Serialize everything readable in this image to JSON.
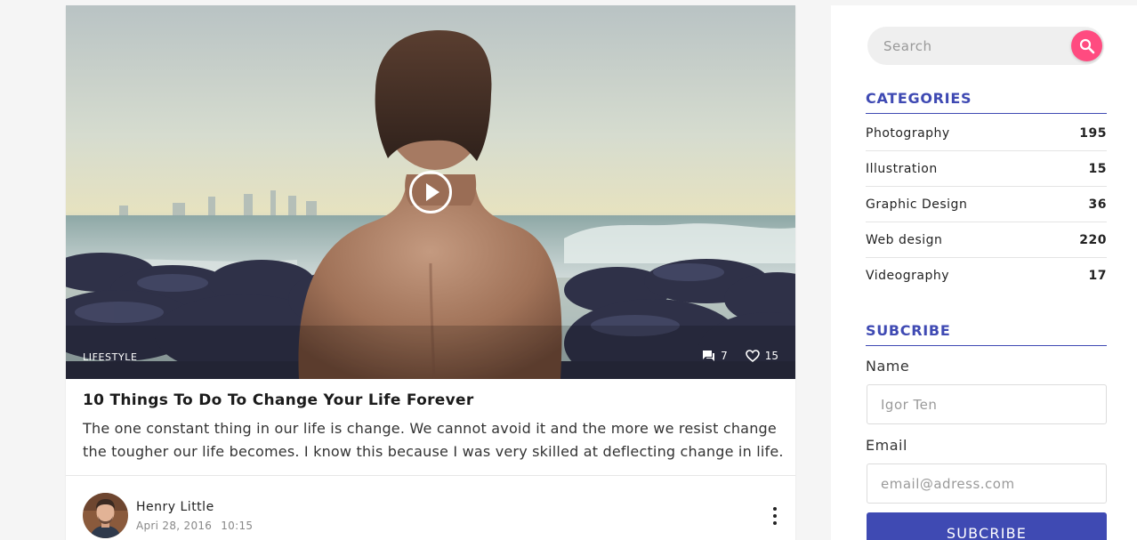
{
  "post": {
    "category_tag": "LIFESTYLE",
    "comments_count": "7",
    "likes_count": "15",
    "title": "10 Things To Do To Change Your Life Forever",
    "excerpt": "The one constant thing in our life is change. We cannot avoid it and the more we resist change the tougher our life becomes. I know this because I was very skilled at deflecting change in life.",
    "author": {
      "name": "Henry Little",
      "date": "Apri 28, 2016",
      "time": "10:15"
    },
    "media_icons": [
      "play-icon",
      "comment-icon",
      "heart-icon",
      "more-vertical-icon"
    ]
  },
  "sidebar": {
    "search": {
      "placeholder": "Search",
      "icon": "search-icon"
    },
    "categories": {
      "title": "CATEGORIES",
      "items": [
        {
          "label": "Photography",
          "count": "195"
        },
        {
          "label": "Illustration",
          "count": "15"
        },
        {
          "label": "Graphic Design",
          "count": "36"
        },
        {
          "label": "Web design",
          "count": "220"
        },
        {
          "label": "Videography",
          "count": "17"
        }
      ]
    },
    "subscribe": {
      "title": "SUBCRIBE",
      "name_label": "Name",
      "name_placeholder": "Igor Ten",
      "email_label": "Email",
      "email_placeholder": "email@adress.com",
      "button_label": "SUBCRIBE"
    }
  },
  "colors": {
    "accent": "#3f4ab3",
    "search_button": "#ff4b80",
    "page_background": "#f5f5f5"
  }
}
